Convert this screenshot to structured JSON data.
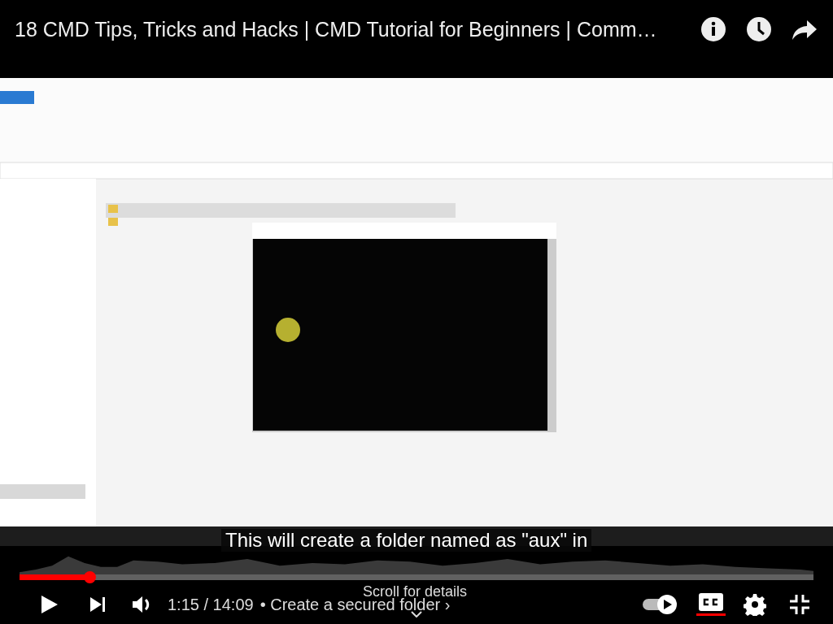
{
  "title": "18 CMD Tips, Tricks and Hacks | CMD Tutorial for Beginners | Comm…",
  "caption": "This will create a folder named as \"aux\" in",
  "progress": {
    "level": 0.088
  },
  "time": "1:15 / 14:09",
  "chapter": "• Create a secured folder ›",
  "scroll_hint": "Scroll for details",
  "autoplay": {
    "on": true
  },
  "captions_button": {
    "on": true
  }
}
